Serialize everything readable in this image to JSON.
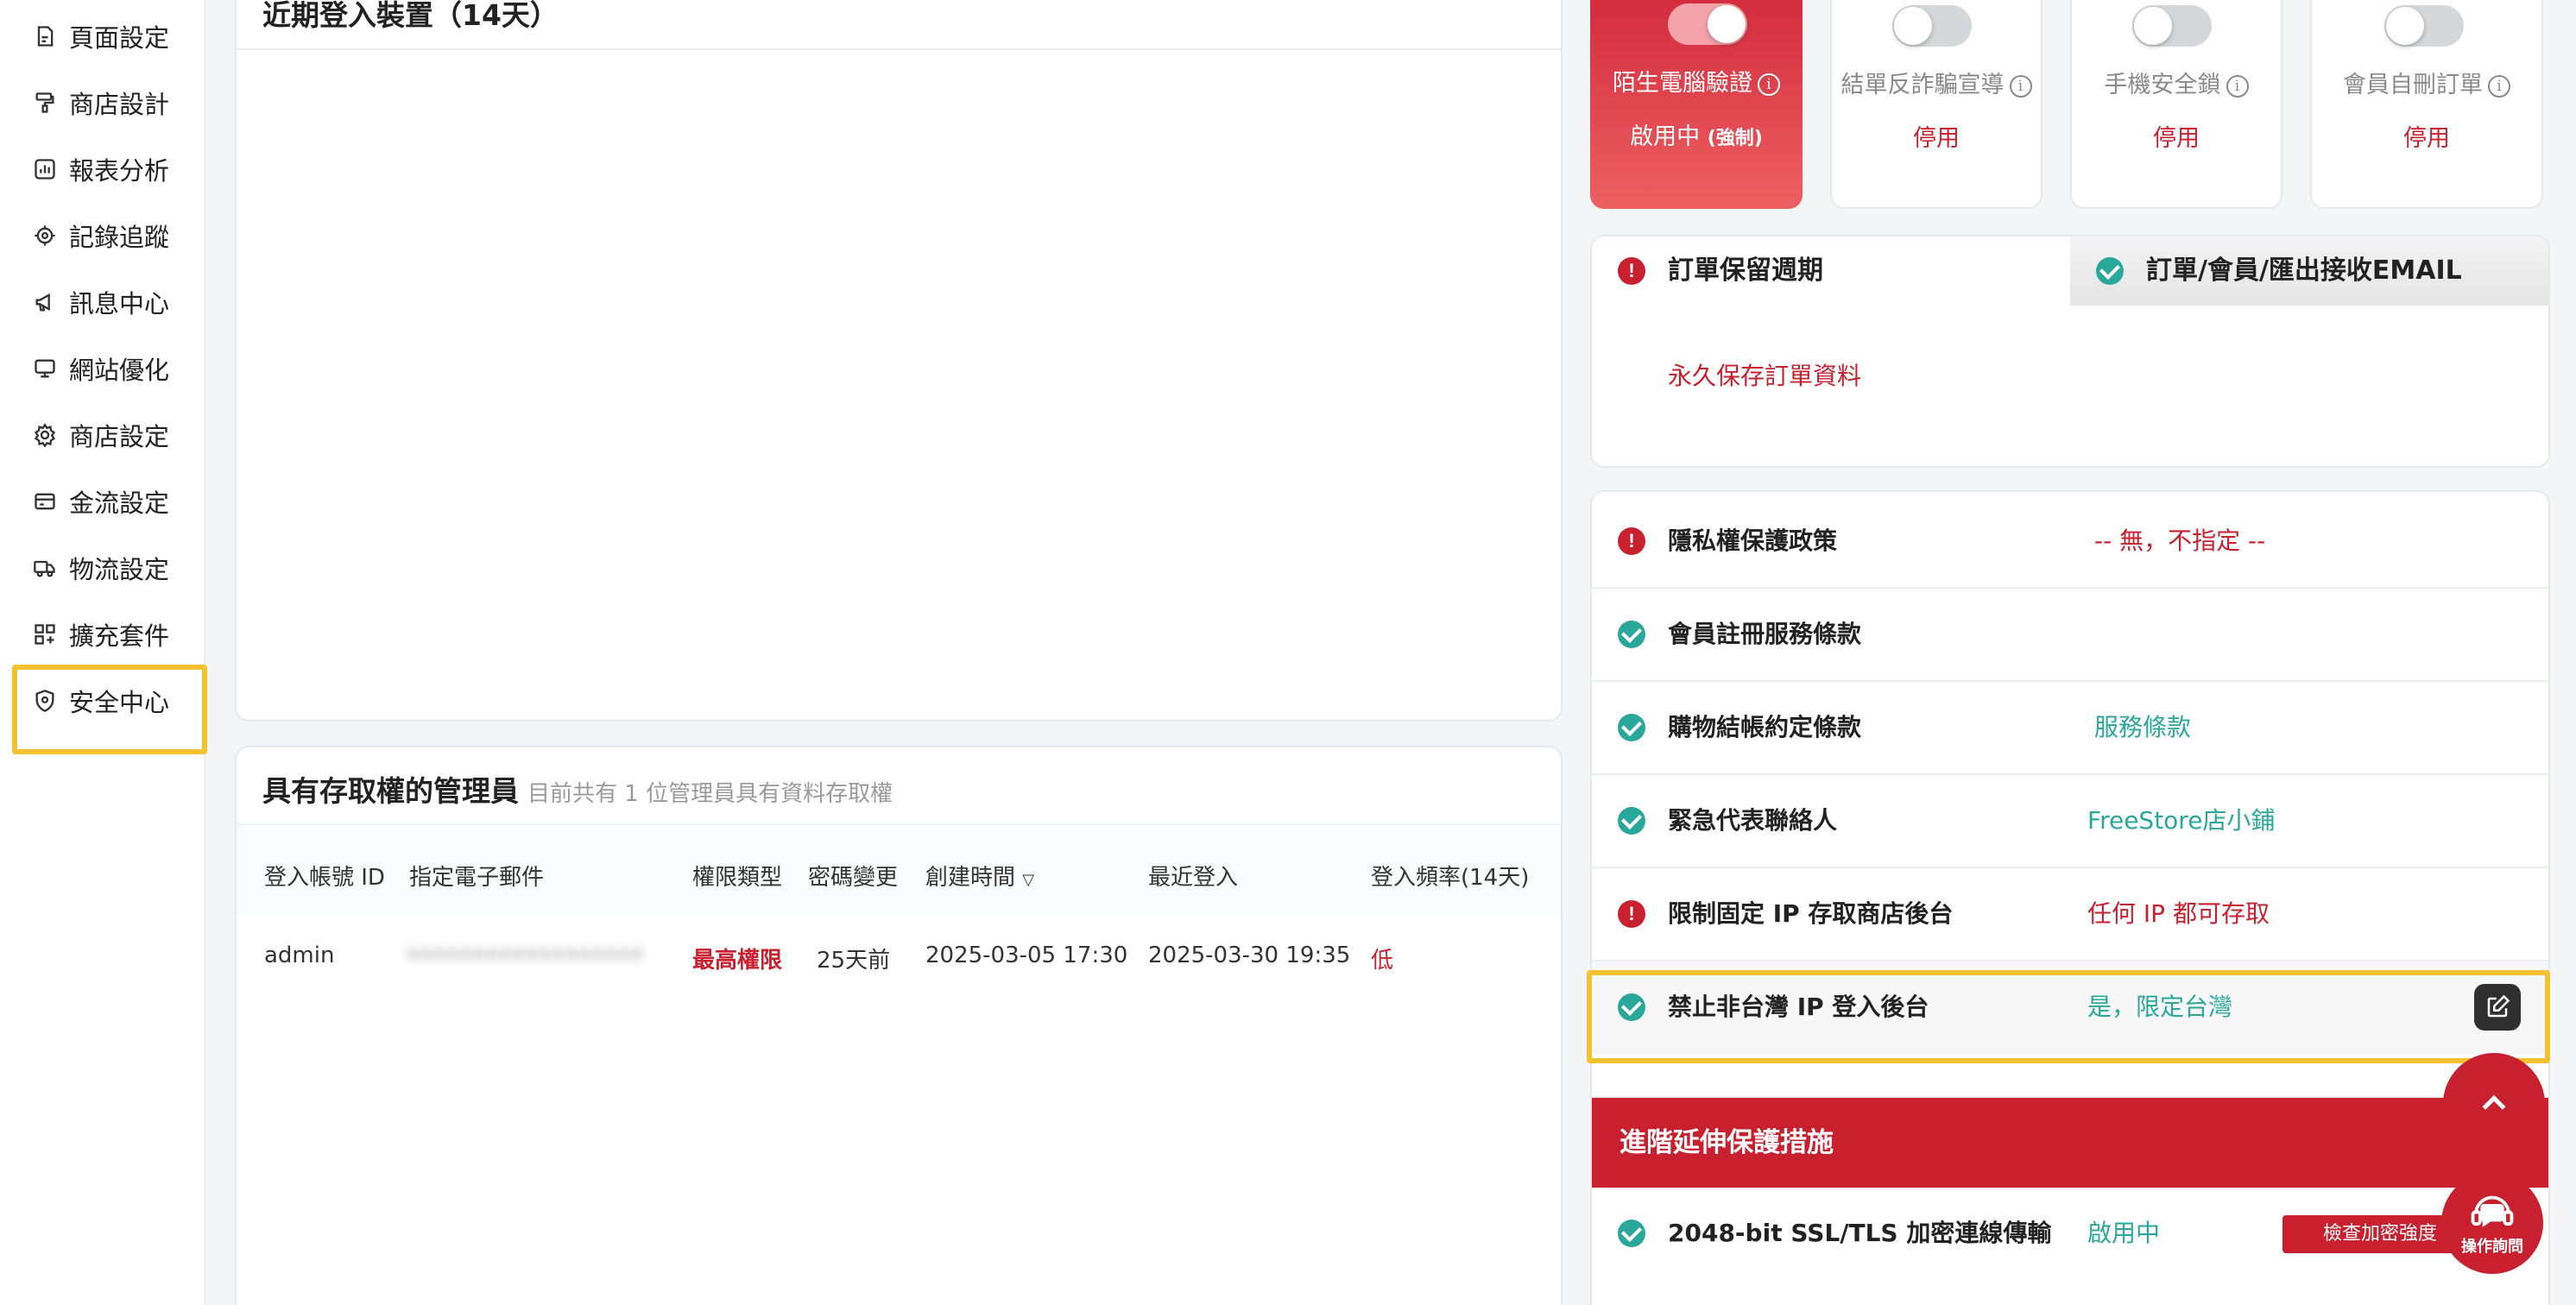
{
  "sidebar": {
    "items": [
      {
        "label": "頁面設定",
        "icon": "page-icon"
      },
      {
        "label": "商店設計",
        "icon": "paint-roller-icon"
      },
      {
        "label": "報表分析",
        "icon": "chart-icon"
      },
      {
        "label": "記錄追蹤",
        "icon": "target-icon"
      },
      {
        "label": "訊息中心",
        "icon": "megaphone-icon"
      },
      {
        "label": "網站優化",
        "icon": "monitor-icon"
      },
      {
        "label": "商店設定",
        "icon": "gear-icon"
      },
      {
        "label": "金流設定",
        "icon": "card-icon"
      },
      {
        "label": "物流設定",
        "icon": "truck-icon"
      },
      {
        "label": "擴充套件",
        "icon": "grid-plus-icon"
      },
      {
        "label": "安全中心",
        "icon": "shield-icon"
      }
    ]
  },
  "devices_panel": {
    "title": "近期登入裝置（14天）"
  },
  "admins_panel": {
    "title": "具有存取權的管理員",
    "subtitle": "目前共有 1 位管理員具有資料存取權",
    "columns": [
      "登入帳號 ID",
      "指定電子郵件",
      "權限類型",
      "密碼變更",
      "創建時間",
      "最近登入",
      "登入頻率(14天)"
    ],
    "rows": [
      {
        "id": "admin",
        "email": "••••••••••••••••••",
        "role": "最高權限",
        "pwd_change": "25天前",
        "created": "2025-03-05 17:30",
        "last_login": "2025-03-30 19:35",
        "frequency": "低"
      }
    ]
  },
  "toggles": [
    {
      "label": "陌生電腦驗證",
      "status": "啟用中",
      "status_tag": "(強制)",
      "on": true
    },
    {
      "label": "結單反詐騙宣導",
      "status": "停用",
      "on": false
    },
    {
      "label": "手機安全鎖",
      "status": "停用",
      "on": false
    },
    {
      "label": "會員自刪訂單",
      "status": "停用",
      "on": false
    }
  ],
  "order_panel": {
    "tab1": "訂單保留週期",
    "tab2": "訂單/會員/匯出接收EMAIL",
    "value": "永久保存訂單資料"
  },
  "settings": [
    {
      "label": "隱私權保護政策",
      "value": "-- 無，不指定 --",
      "status": "error"
    },
    {
      "label": "會員註冊服務條款",
      "value": "",
      "status": "ok"
    },
    {
      "label": "購物結帳約定條款",
      "value": "服務條款",
      "status": "ok"
    },
    {
      "label": "緊急代表聯絡人",
      "value": "FreeStore店小鋪",
      "status": "ok"
    },
    {
      "label": "限制固定 IP 存取商店後台",
      "value": "任何 IP 都可存取",
      "status": "error"
    },
    {
      "label": "禁止非台灣 IP 登入後台",
      "value": "是，限定台灣",
      "status": "ok"
    }
  ],
  "advanced": {
    "title": "進階延伸保護措施",
    "row_label": "2048-bit SSL/TLS 加密連線傳輸",
    "row_value": "啟用中",
    "button": "檢查加密強度"
  },
  "help_label": "操作詢問",
  "colors": {
    "brand_red": "#c8202f",
    "teal": "#2aa79b",
    "highlight": "#f2c230"
  }
}
